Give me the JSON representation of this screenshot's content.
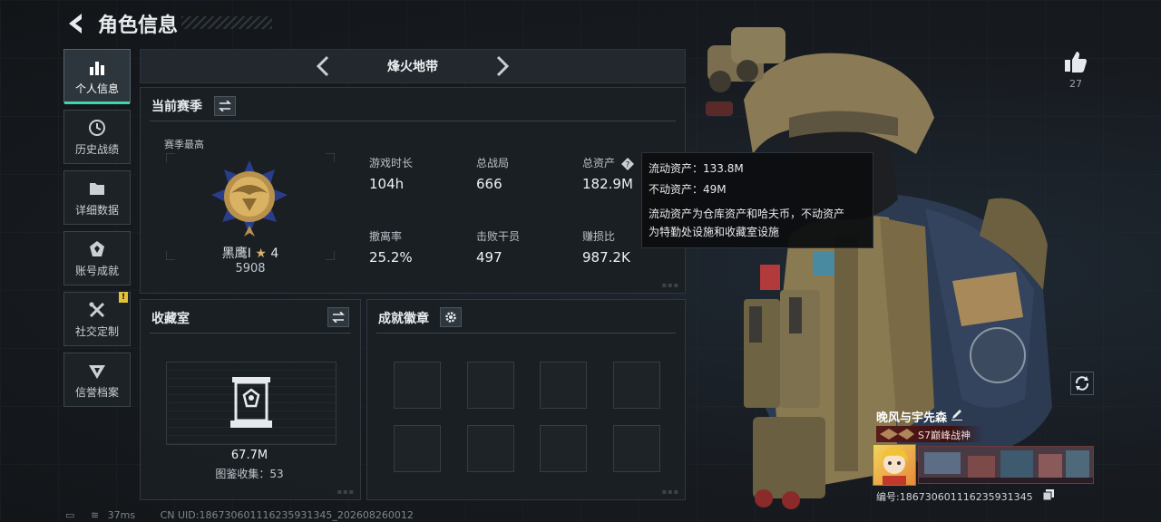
{
  "header": {
    "title": "角色信息"
  },
  "sidebar": {
    "items": [
      {
        "label": "个人信息",
        "icon": "bar-chart-icon",
        "active": true
      },
      {
        "label": "历史战绩",
        "icon": "history-icon"
      },
      {
        "label": "详细数据",
        "icon": "folder-icon"
      },
      {
        "label": "账号成就",
        "icon": "achievement-icon"
      },
      {
        "label": "社交定制",
        "icon": "tools-icon",
        "badge": "!"
      },
      {
        "label": "信誉档案",
        "icon": "credit-icon"
      }
    ]
  },
  "map_selector": {
    "current": "烽火地带"
  },
  "season": {
    "title": "当前赛季",
    "best_label": "赛季最高",
    "rank_name": "黑鹰Ⅰ",
    "rank_stars": "4",
    "rank_score": "5908",
    "stats": [
      {
        "label": "游戏时长",
        "value": "104h"
      },
      {
        "label": "总战局",
        "value": "666"
      },
      {
        "label": "总资产",
        "value": "182.9M",
        "help": true
      },
      {
        "label": "撤离率",
        "value": "25.2%"
      },
      {
        "label": "击败干员",
        "value": "497"
      },
      {
        "label": "赚损比",
        "value": "987.2K"
      }
    ]
  },
  "tooltip": {
    "liquid": "流动资产：133.8M",
    "fixed": "不动资产：49M",
    "note_line1": "流动资产为仓库资产和哈夫币，不动资产",
    "note_line2": "为特勤处设施和收藏室设施"
  },
  "collection": {
    "title": "收藏室",
    "value": "67.7M",
    "catalog": "图鉴收集：53"
  },
  "achievements": {
    "title": "成就徽章"
  },
  "profile": {
    "likes": "27",
    "player_name": "晚风与宇先森",
    "title_tag": "S7巅峰战神",
    "player_id": "编号:1867306011162359313​45"
  },
  "status_bar": {
    "ping": "37ms",
    "uid": "CN UID:1867306011162359313​45_202608260012"
  },
  "colors": {
    "accent": "#3ed6a8",
    "badge": "#e3c23a"
  }
}
